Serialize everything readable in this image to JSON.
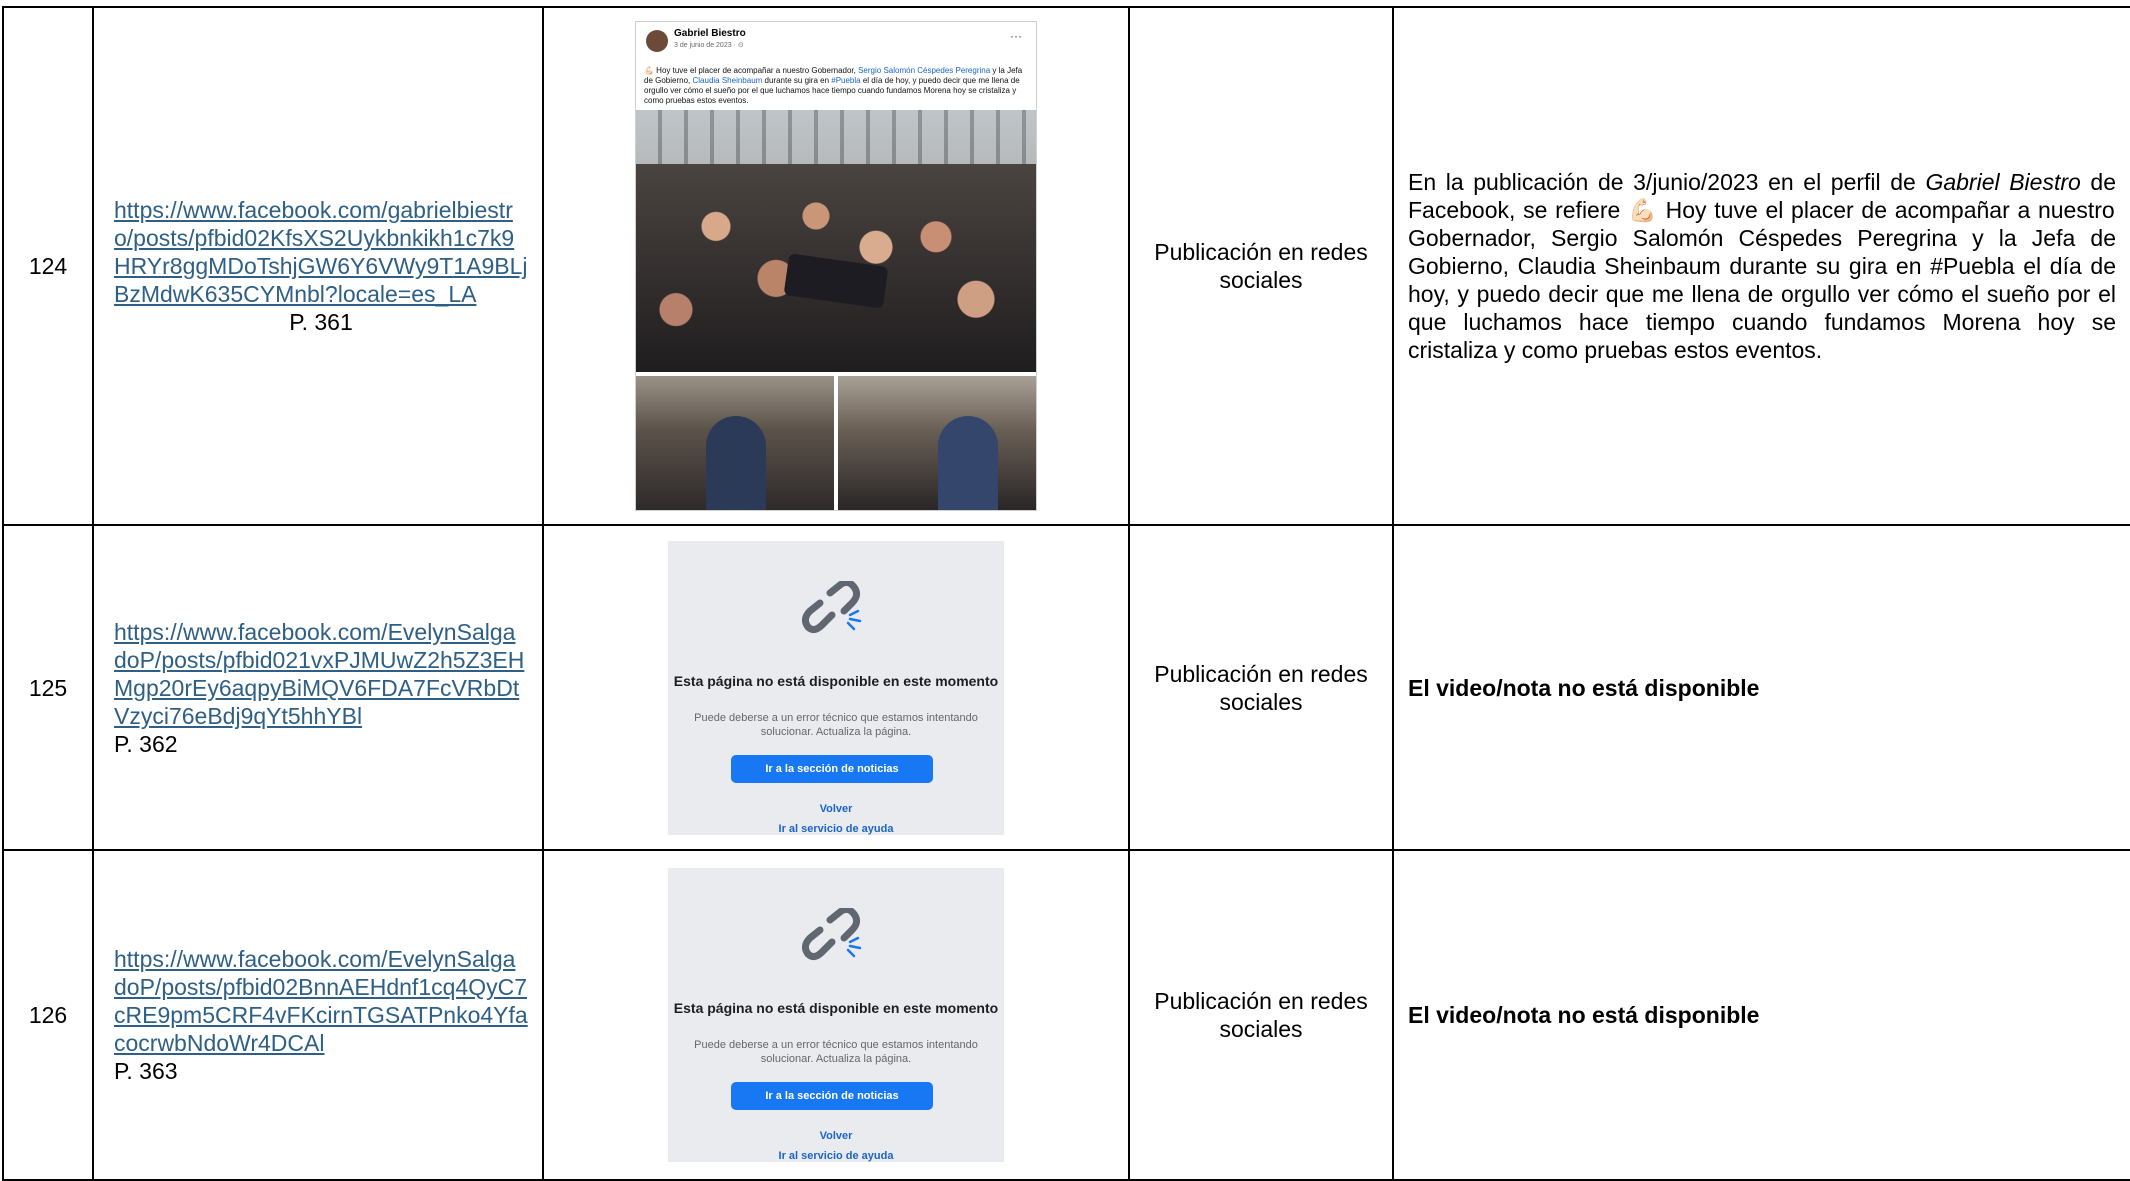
{
  "rows": [
    {
      "number": "124",
      "url": "https://www.facebook.com/gabrielbiestro/posts/pfbid02KfsXS2Uykbnkikh1c7k9HRYr8ggMDoTshjGW6Y6VWy9T1A9BLjBzMdwK635CYMnbl?locale=es_LA",
      "page": "P. 361",
      "type": "Publicación en redes sociales",
      "description_parts": {
        "before": "En la publicación de 3/junio/2023 en el perfil de ",
        "profile": "Gabriel Biestro",
        "after": " de Facebook, se refiere 💪🏻 Hoy tuve el placer de acompañar a nuestro Gobernador, Sergio Salomón Céspedes Peregrina y la Jefa de Gobierno, Claudia Sheinbaum durante su gira en #Puebla el día de hoy, y puedo decir que me llena de orgullo ver cómo el sueño por el que luchamos hace tiempo cuando fundamos Morena hoy se cristaliza y como pruebas estos eventos."
      },
      "screenshot": {
        "author": "Gabriel Biestro",
        "date": "3 de junio de 2023 · ⊙",
        "menu": "···",
        "text_a": "💪🏻 Hoy tuve el placer de acompañar a nuestro Gobernador, ",
        "link_a": "Sergio Salomón Céspedes Peregrina",
        "text_b": " y la Jefa de Gobierno, ",
        "link_b": "Claudia Sheinbaum",
        "text_c": " durante su gira en ",
        "link_c": "#Puebla",
        "text_d": " el día de hoy, y puedo decir que me llena de orgullo ver cómo el sueño por el que luchamos hace tiempo cuando fundamos Morena hoy se cristaliza y como pruebas estos eventos."
      }
    },
    {
      "number": "125",
      "url": "https://www.facebook.com/EvelynSalgadoP/posts/pfbid021vxPJMUwZ2h5Z3EHMgp20rEy6aqpyBiMQV6FDA7FcVRbDtVzyci76eBdj9qYt5hhYBl",
      "page": "P. 362",
      "type": "Publicación en redes sociales",
      "description": "El video/nota no está disponible",
      "screenshot": {
        "title": "Esta página no está disponible en este momento",
        "subtitle": "Puede deberse a un error técnico que estamos intentando solucionar. Actualiza la página.",
        "button": "Ir a la sección de noticias",
        "link_back": "Volver",
        "link_help": "Ir al servicio de ayuda"
      }
    },
    {
      "number": "126",
      "url": "https://www.facebook.com/EvelynSalgadoP/posts/pfbid02BnnAEHdnf1cq4QyC7cRE9pm5CRF4vFKcirnTGSATPnko4YfacocrwbNdoWr4DCAl",
      "page": "P. 363",
      "type": "Publicación en redes sociales",
      "description": "El video/nota no está disponible",
      "screenshot": {
        "title": "Esta página no está disponible en este momento",
        "subtitle": "Puede deberse a un error técnico que estamos intentando solucionar. Actualiza la página.",
        "button": "Ir a la sección de noticias",
        "link_back": "Volver",
        "link_help": "Ir al servicio de ayuda"
      }
    }
  ]
}
